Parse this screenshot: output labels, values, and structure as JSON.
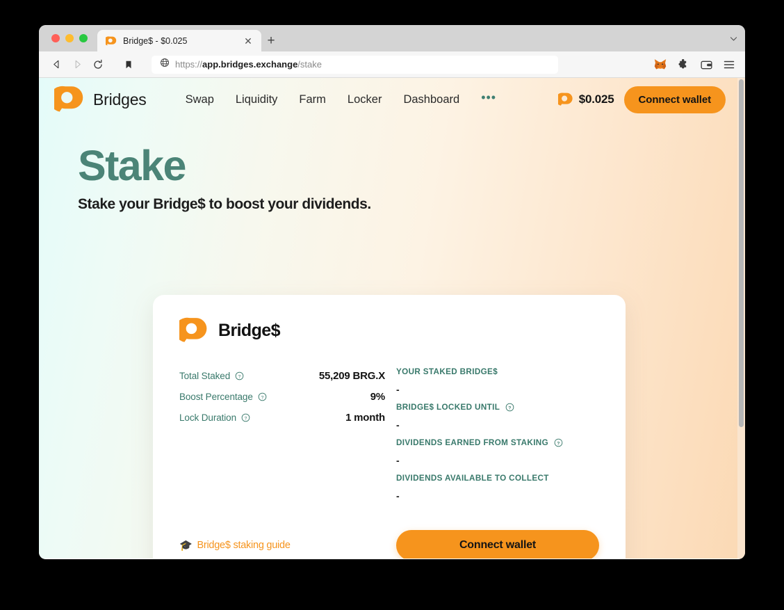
{
  "browser": {
    "tab": {
      "title": "Bridge$ - $0.025",
      "favicon_icon": "bridges-logo-icon",
      "close_icon": "close-icon",
      "new_tab_icon": "plus-icon",
      "tab_list_icon": "chevron-down-icon"
    },
    "toolbar": {
      "back_icon": "back-arrow-icon",
      "forward_icon": "forward-arrow-icon",
      "reload_icon": "reload-icon",
      "bookmark_icon": "bookmark-icon",
      "url_scheme": "https://",
      "url_domain": "app.bridges.exchange",
      "url_path": "/stake",
      "site_icon": "globe-icon",
      "extensions": [
        {
          "name": "metamask-icon"
        },
        {
          "name": "puzzle-piece-icon"
        },
        {
          "name": "wallet-icon"
        },
        {
          "name": "hamburger-menu-icon"
        }
      ]
    }
  },
  "site": {
    "brand": {
      "name": "Bridges",
      "logo_icon": "bridges-logo-icon"
    },
    "nav_links": [
      {
        "label": "Swap"
      },
      {
        "label": "Liquidity"
      },
      {
        "label": "Farm"
      },
      {
        "label": "Locker"
      },
      {
        "label": "Dashboard"
      }
    ],
    "nav_more_label": "•••",
    "price": {
      "value": "$0.025",
      "logo_icon": "bridges-token-icon"
    },
    "connect_wallet_label": "Connect wallet"
  },
  "hero": {
    "title": "Stake",
    "subtitle": "Stake your Bridge$ to boost your dividends."
  },
  "card": {
    "title": "Bridge$",
    "logo_icon": "bridges-logo-icon",
    "left_stats": [
      {
        "label": "Total Staked",
        "has_help": true,
        "value": "55,209 BRG.X"
      },
      {
        "label": "Boost Percentage",
        "has_help": true,
        "value": "9%"
      },
      {
        "label": "Lock Duration",
        "has_help": true,
        "value": "1 month"
      }
    ],
    "right_stats": [
      {
        "label": "YOUR STAKED BRIDGE$",
        "has_help": false,
        "value": "-"
      },
      {
        "label": "BRIDGE$ LOCKED UNTIL",
        "has_help": true,
        "value": "-"
      },
      {
        "label": "DIVIDENDS EARNED FROM STAKING",
        "has_help": true,
        "value": "-"
      },
      {
        "label": "DIVIDENDS AVAILABLE TO COLLECT",
        "has_help": false,
        "value": "-"
      }
    ],
    "guide_link": {
      "emoji": "🎓",
      "label": "Bridge$ staking guide"
    },
    "connect_wallet_label": "Connect wallet"
  },
  "colors": {
    "brand_orange": "#f6941d",
    "teal": "#39796b",
    "hero_green": "#4b8477"
  }
}
